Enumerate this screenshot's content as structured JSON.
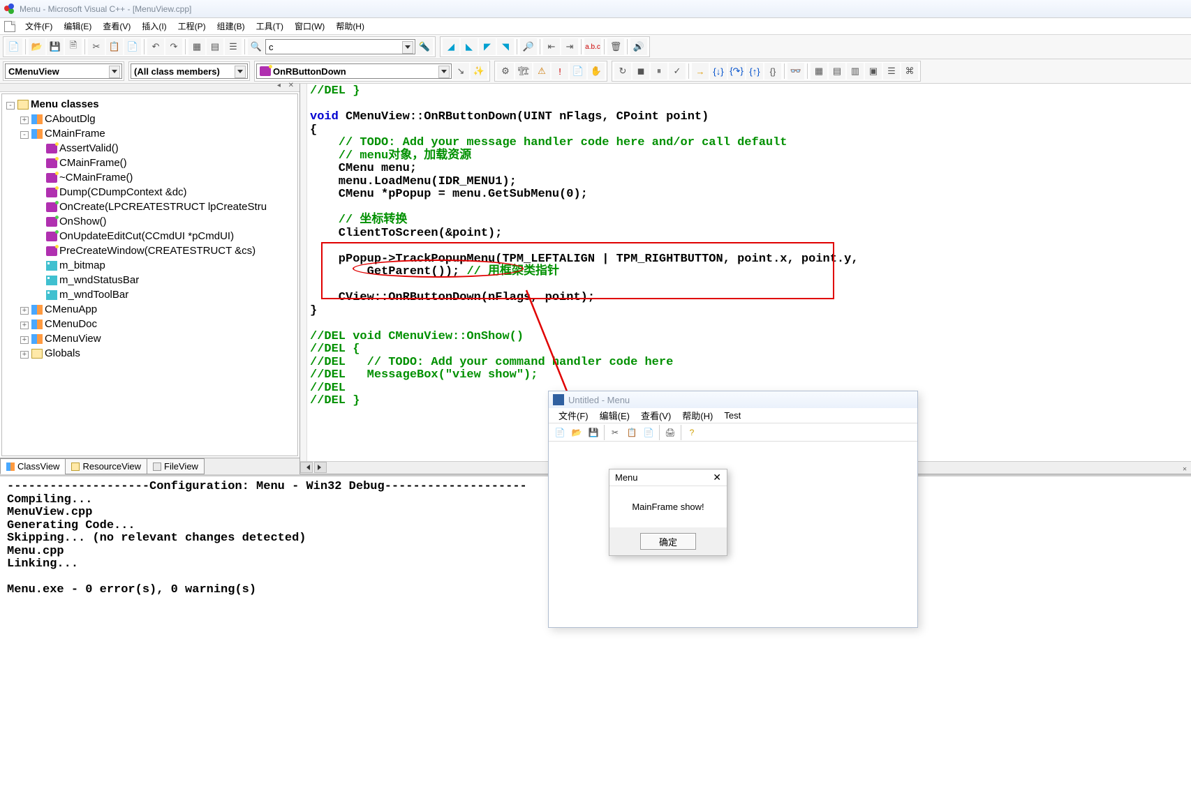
{
  "title": "Menu - Microsoft Visual C++ - [MenuView.cpp]",
  "menu": {
    "file": "文件(F)",
    "edit": "编辑(E)",
    "view": "查看(V)",
    "insert": "插入(I)",
    "project": "工程(P)",
    "build": "组建(B)",
    "tools": "工具(T)",
    "window": "窗口(W)",
    "help": "帮助(H)"
  },
  "combobox": {
    "class": "CMenuView",
    "filter": "(All class members)",
    "member": "OnRButtonDown",
    "find": "c"
  },
  "tree": {
    "root": "Menu classes",
    "aboutdlg": "CAboutDlg",
    "mainframe": "CMainFrame",
    "mf": {
      "assert": "AssertValid()",
      "ctor": "CMainFrame()",
      "dtor": "~CMainFrame()",
      "dump": "Dump(CDumpContext &dc)",
      "oncreate": "OnCreate(LPCREATESTRUCT lpCreateStru",
      "onshow": "OnShow()",
      "onupdate": "OnUpdateEditCut(CCmdUI *pCmdUI)",
      "precreate": "PreCreateWindow(CREATESTRUCT &cs)",
      "bitmap": "m_bitmap",
      "status": "m_wndStatusBar",
      "toolbar": "m_wndToolBar"
    },
    "menuapp": "CMenuApp",
    "menudoc": "CMenuDoc",
    "menuview": "CMenuView",
    "globals": "Globals"
  },
  "tabs": {
    "class": "ClassView",
    "res": "ResourceView",
    "file": "FileView"
  },
  "code": {
    "l1": "//DEL }",
    "l2": "",
    "l3a": "void",
    "l3b": " CMenuView::OnRButtonDown(UINT nFlags, CPoint point)",
    "l4": "{",
    "l5": "    // TODO: Add your message handler code here and/or call default",
    "l6": "    // menu对象，加载资源",
    "l7": "    CMenu menu;",
    "l8": "    menu.LoadMenu(IDR_MENU1);",
    "l9": "    CMenu *pPopup = menu.GetSubMenu(0);",
    "l10": "",
    "l11": "    // 坐标转换",
    "l12": "    ClientToScreen(&point);",
    "l13": "",
    "l14": "    pPopup->TrackPopupMenu(TPM_LEFTALIGN | TPM_RIGHTBUTTON, point.x, point.y,",
    "l15a": "        GetParent()); ",
    "l15b": "// 用框架类指针",
    "l16": "",
    "l17": "    CView::OnRButtonDown(nFlags, point);",
    "l18": "}",
    "l19": "",
    "l20": "//DEL void CMenuView::OnShow()",
    "l21": "//DEL {",
    "l22": "//DEL   // TODO: Add your command handler code here",
    "l23": "//DEL   MessageBox(\"view show\");",
    "l24": "//DEL",
    "l25": "//DEL }"
  },
  "output": "--------------------Configuration: Menu - Win32 Debug--------------------\nCompiling...\nMenuView.cpp\nGenerating Code...\nSkipping... (no relevant changes detected)\nMenu.cpp\nLinking...\n\nMenu.exe - 0 error(s), 0 warning(s)",
  "child": {
    "title": "Untitled - Menu",
    "menu": {
      "file": "文件(F)",
      "edit": "编辑(E)",
      "view": "查看(V)",
      "help": "帮助(H)",
      "test": "Test"
    }
  },
  "msgbox": {
    "title": "Menu",
    "text": "MainFrame show!",
    "ok": "确定"
  },
  "toolbar": {
    "abc": "a.b.c"
  }
}
